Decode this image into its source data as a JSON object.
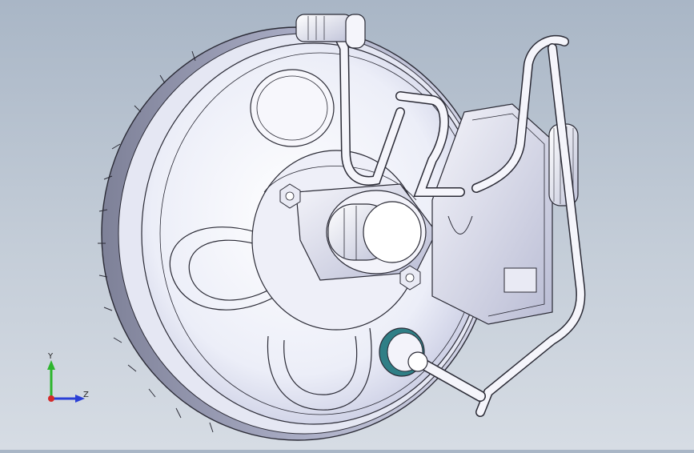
{
  "viewport": {
    "model": "brake-booster-assembly",
    "background_top": "#a9b6c6",
    "background_bottom": "#d6dce4",
    "part_fill": "#f2f2f8",
    "part_shade": "#c9cbe0",
    "edge_color": "#2a2a35",
    "seal_color": "#2f7f86"
  },
  "triad": {
    "y_label": "Y",
    "z_label": "Z",
    "y_color": "#2db52d",
    "z_color": "#2a3fd6",
    "x_color": "#d42a2a"
  }
}
